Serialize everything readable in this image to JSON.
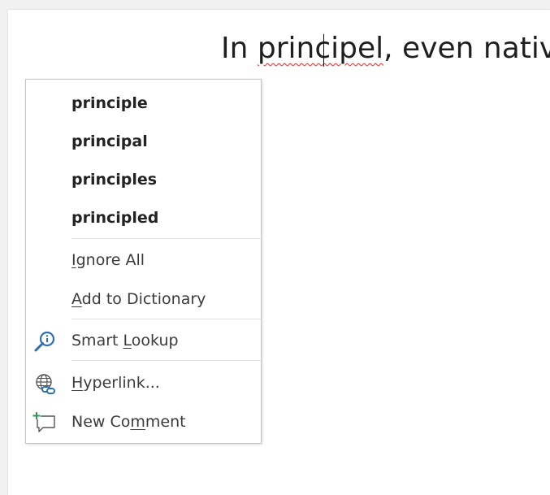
{
  "document": {
    "line_before": "In ",
    "misspelled_word": "principel",
    "line_after": ", even native"
  },
  "context_menu": {
    "suggestions": [
      "principle",
      "principal",
      "principles",
      "principled"
    ],
    "ignore_all": {
      "pre": "",
      "mnemonic": "I",
      "post": "gnore All"
    },
    "add_to_dictionary": {
      "pre": "",
      "mnemonic": "A",
      "post": "dd to Dictionary"
    },
    "smart_lookup": {
      "pre": "Smart ",
      "mnemonic": "L",
      "post": "ookup"
    },
    "hyperlink": {
      "pre": "",
      "mnemonic": "H",
      "post": "yperlink..."
    },
    "new_comment": {
      "pre": "New Co",
      "mnemonic": "m",
      "post": "ment"
    }
  },
  "icons": {
    "smart_lookup": "magnifier-info-icon",
    "hyperlink": "globe-link-icon",
    "new_comment": "new-comment-icon"
  },
  "colors": {
    "spell_underline": "#e02b2b",
    "icon_blue": "#2e6eb5",
    "comment_plus": "#2f9a4a"
  }
}
